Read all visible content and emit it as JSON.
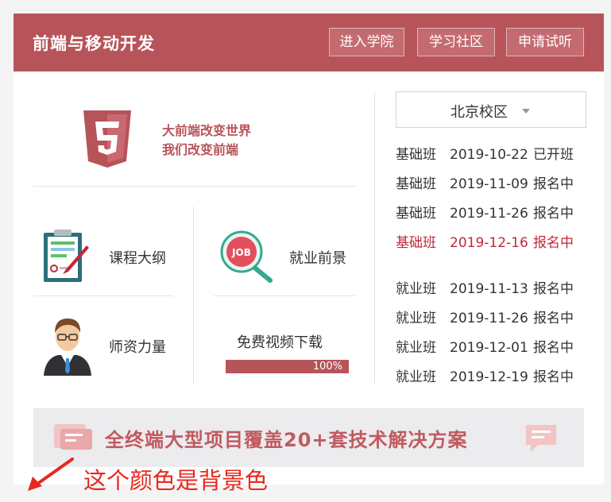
{
  "header": {
    "title": "前端与移动开发",
    "buttons": [
      "进入学院",
      "学习社区",
      "申请试听"
    ]
  },
  "left_panel": {
    "logo": {
      "icon": "html5-logo-icon",
      "digit": "5"
    },
    "slogan_line1": "大前端改变世界",
    "slogan_line2": "我们改变前端",
    "features": {
      "syllabus": "课程大纲",
      "employment": "就业前景",
      "teachers": "师资力量",
      "video_download": "免费视频下载"
    },
    "job_badge": "JOB",
    "progress": {
      "value": 1.0,
      "label": "100%"
    }
  },
  "right_panel": {
    "campus_select": "北京校区",
    "schedule": [
      {
        "class": "基础班",
        "date": "2019-10-22",
        "status": "已开班",
        "highlight": false
      },
      {
        "class": "基础班",
        "date": "2019-11-09",
        "status": "报名中",
        "highlight": false
      },
      {
        "class": "基础班",
        "date": "2019-11-26",
        "status": "报名中",
        "highlight": false
      },
      {
        "class": "基础班",
        "date": "2019-12-16",
        "status": "报名中",
        "highlight": true
      },
      {
        "class": "就业班",
        "date": "2019-11-13",
        "status": "报名中",
        "highlight": false
      },
      {
        "class": "就业班",
        "date": "2019-11-26",
        "status": "报名中",
        "highlight": false
      },
      {
        "class": "就业班",
        "date": "2019-12-01",
        "status": "报名中",
        "highlight": false
      },
      {
        "class": "就业班",
        "date": "2019-12-19",
        "status": "报名中",
        "highlight": false
      }
    ]
  },
  "banner": {
    "text": "全终端大型项目覆盖20+套技术解决方案"
  },
  "annotation": {
    "text": "这个颜色是背景色"
  },
  "colors": {
    "brand": "#b7545a",
    "highlight": "#c0283a",
    "page_background": "#f4f4f4",
    "annotation": "#e8281f"
  }
}
